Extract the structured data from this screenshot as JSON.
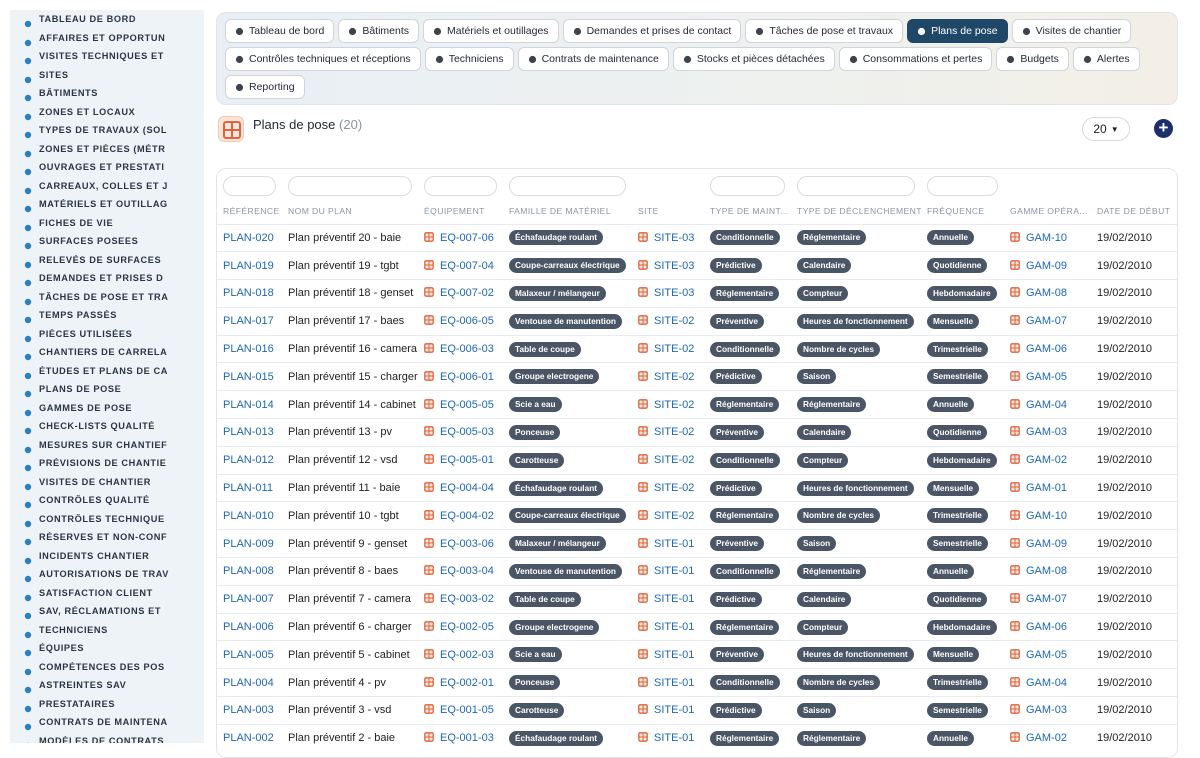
{
  "sidebar": {
    "items": [
      {
        "label": "TABLEAU DE BORD",
        "icon": "gauge-icon"
      },
      {
        "label": "AFFAIRES ET OPPORTUN",
        "icon": "target-icon"
      },
      {
        "label": "VISITES TECHNIQUES ET",
        "icon": "clipboard-icon"
      },
      {
        "label": "SITES",
        "icon": "map-pin-icon"
      },
      {
        "label": "BÂTIMENTS",
        "icon": "building-icon"
      },
      {
        "label": "ZONES ET LOCAUX",
        "icon": "layers-icon"
      },
      {
        "label": "TYPES DE TRAVAUX (SOL",
        "icon": "hierarchy-icon"
      },
      {
        "label": "ZONES ET PIÈCES (MÉTR",
        "icon": "grid-icon"
      },
      {
        "label": "OUVRAGES ET PRESTATI",
        "icon": "plug-icon"
      },
      {
        "label": "CARREAUX, COLLES ET J",
        "icon": "tools-icon"
      },
      {
        "label": "MATÉRIELS ET OUTILLAG",
        "icon": "gears-icon"
      },
      {
        "label": "FICHES DE VIE",
        "icon": "file-icon"
      },
      {
        "label": "SURFACES POSEES",
        "icon": "history-icon"
      },
      {
        "label": "RELEVÉS DE SURFACES",
        "icon": "ruler-icon"
      },
      {
        "label": "DEMANDES ET PRISES D",
        "icon": "question-icon"
      },
      {
        "label": "TÂCHES DE POSE ET TRA",
        "icon": "tasks-icon"
      },
      {
        "label": "TEMPS PASSÉS",
        "icon": "clock-icon"
      },
      {
        "label": "PIÈCES UTILISÉES",
        "icon": "puzzle-icon"
      },
      {
        "label": "CHANTIERS DE CARRELA",
        "icon": "hammer-icon"
      },
      {
        "label": "ÉTUDES ET PLANS DE CA",
        "icon": "doc-icon"
      },
      {
        "label": "PLANS DE POSE",
        "icon": "table-icon"
      },
      {
        "label": "GAMMES DE POSE",
        "icon": "list-icon"
      },
      {
        "label": "CHECK-LISTS QUALITÉ",
        "icon": "checklist-icon"
      },
      {
        "label": "MESURES SUR CHANTIEF",
        "icon": "measure-icon"
      },
      {
        "label": "PRÉVISIONS DE CHANTIE",
        "icon": "forecast-icon"
      },
      {
        "label": "VISITES DE CHANTIER",
        "icon": "visit-icon"
      },
      {
        "label": "CONTRÔLES QUALITÉ",
        "icon": "shield-icon"
      },
      {
        "label": "CONTRÔLES TECHNIQUE",
        "icon": "clipboard-check-icon"
      },
      {
        "label": "RÉSERVES ET NON-CONF",
        "icon": "warning-icon"
      },
      {
        "label": "INCIDENTS CHANTIER",
        "icon": "alert-icon"
      },
      {
        "label": "AUTORISATIONS DE TRAV",
        "icon": "permit-icon"
      },
      {
        "label": "SATISFACTION CLIENT",
        "icon": "smile-icon"
      },
      {
        "label": "SAV, RÉCLAMATIONS ET",
        "icon": "chat-icon"
      },
      {
        "label": "TECHNICIENS",
        "icon": "helmet-icon"
      },
      {
        "label": "ÉQUIPES",
        "icon": "team-icon"
      },
      {
        "label": "COMPÉTENCES DES POS",
        "icon": "skill-icon"
      },
      {
        "label": "ASTREINTES SAV",
        "icon": "phone-icon"
      },
      {
        "label": "PRESTATAIRES",
        "icon": "handshake-icon"
      },
      {
        "label": "CONTRATS DE MAINTENA",
        "icon": "contract-icon"
      },
      {
        "label": "MODÈLES DE CONTRATS",
        "icon": "template-icon"
      }
    ]
  },
  "tabs": {
    "row1": [
      {
        "label": "Tableau de bord",
        "icon": "gauge-icon",
        "active": false
      },
      {
        "label": "Bâtiments",
        "icon": "building-icon",
        "active": false
      },
      {
        "label": "Matériels et outillages",
        "icon": "gears-icon",
        "active": false
      },
      {
        "label": "Demandes et prises de contact",
        "icon": "question-icon",
        "active": false
      },
      {
        "label": "Tâches de pose et travaux",
        "icon": "tasks-icon",
        "active": false
      },
      {
        "label": "Plans de pose",
        "icon": "table-icon",
        "active": true
      },
      {
        "label": "Visites de chantier",
        "icon": "visit-icon",
        "active": false
      }
    ],
    "row2": [
      {
        "label": "Contrôles techniques et réceptions",
        "icon": "clipboard-check-icon",
        "active": false
      },
      {
        "label": "Techniciens",
        "icon": "helmet-icon",
        "active": false
      },
      {
        "label": "Contrats de maintenance",
        "icon": "contract-icon",
        "active": false
      },
      {
        "label": "Stocks et pièces détachées",
        "icon": "boxes-icon",
        "active": false
      },
      {
        "label": "Consommations et pertes",
        "icon": "bolt-icon",
        "active": false
      },
      {
        "label": "Budgets",
        "icon": "money-icon",
        "active": false
      },
      {
        "label": "Alertes",
        "icon": "bell-icon",
        "active": false
      }
    ],
    "row3": [
      {
        "label": "Reporting",
        "icon": "chart-pie-icon",
        "active": false
      }
    ]
  },
  "page": {
    "title": "Plans de pose",
    "count": "(20)",
    "per_page": "20",
    "add_label": "+"
  },
  "table": {
    "columns": [
      "RÉFÉRENCE",
      "NOM DU PLAN",
      "ÉQUIPEMENT",
      "FAMILLE DE MATÉRIEL",
      "SITE",
      "TYPE DE MAINT...",
      "TYPE DE DÉCLENCHEMENT",
      "FRÉQUENCE",
      "GAMME OPÉRA...",
      "DATE DE DÉBUT"
    ],
    "rows": [
      [
        "PLAN-020",
        "Plan préventif 20 - baie",
        "EQ-007-06",
        "Échafaudage roulant",
        "SITE-03",
        "Conditionnelle",
        "Réglementaire",
        "Annuelle",
        "GAM-10",
        "19/02/2010"
      ],
      [
        "PLAN-019",
        "Plan préventif 19 - tgbt",
        "EQ-007-04",
        "Coupe-carreaux électrique",
        "SITE-03",
        "Prédictive",
        "Calendaire",
        "Quotidienne",
        "GAM-09",
        "19/02/2010"
      ],
      [
        "PLAN-018",
        "Plan préventif 18 - genset",
        "EQ-007-02",
        "Malaxeur / mélangeur",
        "SITE-03",
        "Réglementaire",
        "Compteur",
        "Hebdomadaire",
        "GAM-08",
        "19/02/2010"
      ],
      [
        "PLAN-017",
        "Plan préventif 17 - baes",
        "EQ-006-05",
        "Ventouse de manutention",
        "SITE-02",
        "Préventive",
        "Heures de fonctionnement",
        "Mensuelle",
        "GAM-07",
        "19/02/2010"
      ],
      [
        "PLAN-016",
        "Plan préventif 16 - camera",
        "EQ-006-03",
        "Table de coupe",
        "SITE-02",
        "Conditionnelle",
        "Nombre de cycles",
        "Trimestrielle",
        "GAM-06",
        "19/02/2010"
      ],
      [
        "PLAN-015",
        "Plan préventif 15 - charger",
        "EQ-006-01",
        "Groupe electrogene",
        "SITE-02",
        "Prédictive",
        "Saison",
        "Semestrielle",
        "GAM-05",
        "19/02/2010"
      ],
      [
        "PLAN-014",
        "Plan préventif 14 - cabinet",
        "EQ-005-05",
        "Scie a eau",
        "SITE-02",
        "Réglementaire",
        "Réglementaire",
        "Annuelle",
        "GAM-04",
        "19/02/2010"
      ],
      [
        "PLAN-013",
        "Plan préventif 13 - pv",
        "EQ-005-03",
        "Ponceuse",
        "SITE-02",
        "Préventive",
        "Calendaire",
        "Quotidienne",
        "GAM-03",
        "19/02/2010"
      ],
      [
        "PLAN-012",
        "Plan préventif 12 - vsd",
        "EQ-005-01",
        "Carotteuse",
        "SITE-02",
        "Conditionnelle",
        "Compteur",
        "Hebdomadaire",
        "GAM-02",
        "19/02/2010"
      ],
      [
        "PLAN-011",
        "Plan préventif 11 - baie",
        "EQ-004-04",
        "Échafaudage roulant",
        "SITE-02",
        "Prédictive",
        "Heures de fonctionnement",
        "Mensuelle",
        "GAM-01",
        "19/02/2010"
      ],
      [
        "PLAN-010",
        "Plan préventif 10 - tgbt",
        "EQ-004-02",
        "Coupe-carreaux électrique",
        "SITE-02",
        "Réglementaire",
        "Nombre de cycles",
        "Trimestrielle",
        "GAM-10",
        "19/02/2010"
      ],
      [
        "PLAN-009",
        "Plan préventif 9 - genset",
        "EQ-003-06",
        "Malaxeur / mélangeur",
        "SITE-01",
        "Préventive",
        "Saison",
        "Semestrielle",
        "GAM-09",
        "19/02/2010"
      ],
      [
        "PLAN-008",
        "Plan préventif 8 - baes",
        "EQ-003-04",
        "Ventouse de manutention",
        "SITE-01",
        "Conditionnelle",
        "Réglementaire",
        "Annuelle",
        "GAM-08",
        "19/02/2010"
      ],
      [
        "PLAN-007",
        "Plan préventif 7 - camera",
        "EQ-003-02",
        "Table de coupe",
        "SITE-01",
        "Prédictive",
        "Calendaire",
        "Quotidienne",
        "GAM-07",
        "19/02/2010"
      ],
      [
        "PLAN-006",
        "Plan préventif 6 - charger",
        "EQ-002-05",
        "Groupe electrogene",
        "SITE-01",
        "Réglementaire",
        "Compteur",
        "Hebdomadaire",
        "GAM-06",
        "19/02/2010"
      ],
      [
        "PLAN-005",
        "Plan préventif 5 - cabinet",
        "EQ-002-03",
        "Scie a eau",
        "SITE-01",
        "Préventive",
        "Heures de fonctionnement",
        "Mensuelle",
        "GAM-05",
        "19/02/2010"
      ],
      [
        "PLAN-004",
        "Plan préventif 4 - pv",
        "EQ-002-01",
        "Ponceuse",
        "SITE-01",
        "Conditionnelle",
        "Nombre de cycles",
        "Trimestrielle",
        "GAM-04",
        "19/02/2010"
      ],
      [
        "PLAN-003",
        "Plan préventif 3 - vsd",
        "EQ-001-05",
        "Carotteuse",
        "SITE-01",
        "Prédictive",
        "Saison",
        "Semestrielle",
        "GAM-03",
        "19/02/2010"
      ],
      [
        "PLAN-002",
        "Plan préventif 2 - baie",
        "EQ-001-03",
        "Échafaudage roulant",
        "SITE-01",
        "Réglementaire",
        "Réglementaire",
        "Annuelle",
        "GAM-02",
        "19/02/2010"
      ]
    ]
  },
  "colors": {
    "accent": "#1f4868",
    "link": "#1d67b5",
    "chip": "#4a5565",
    "ref_icon": "#d9663f"
  }
}
